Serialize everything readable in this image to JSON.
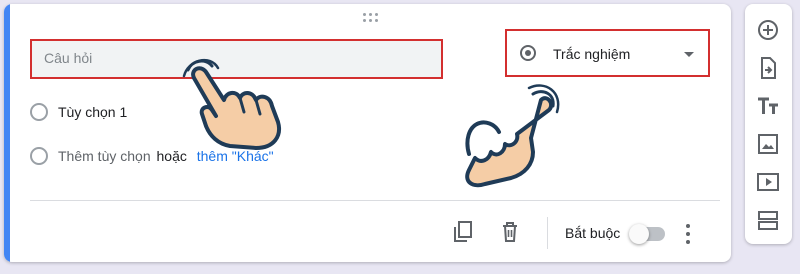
{
  "question": {
    "placeholder": "Câu hỏi"
  },
  "question_type": {
    "label": "Trắc nghiệm",
    "icon": "radio-button-icon"
  },
  "options": [
    {
      "label": "Tùy chọn 1"
    }
  ],
  "add_option": {
    "add_text": "Thêm tùy chọn",
    "or_text": "hoặc",
    "add_other_text": "thêm \"Khác\""
  },
  "footer": {
    "required_label": "Bắt buộc",
    "required_on": false,
    "icons": [
      "duplicate-icon",
      "delete-icon",
      "more-vert-icon"
    ]
  },
  "side_toolbar": {
    "icons": [
      "add-question-icon",
      "import-questions-icon",
      "add-title-icon",
      "add-image-icon",
      "add-video-icon",
      "add-section-icon"
    ]
  },
  "colors": {
    "accent": "#4285f4",
    "highlight": "#d32f2f",
    "link": "#1a73e8",
    "hand_fill": "#f5cda6",
    "hand_outline": "#1f3b57"
  }
}
